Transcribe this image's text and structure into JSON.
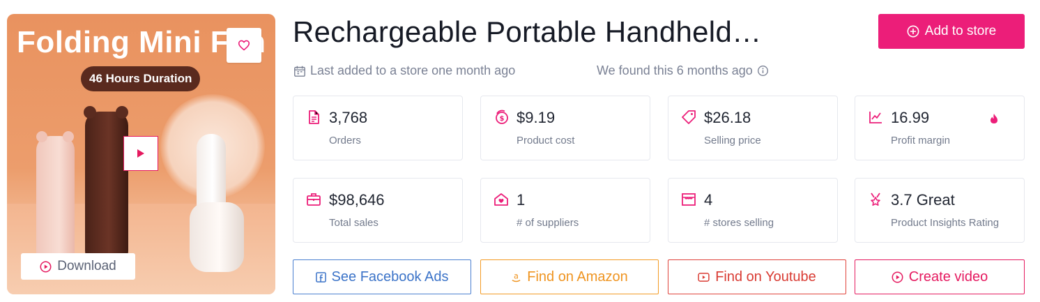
{
  "colors": {
    "accent": "#ec1e79",
    "facebook": "#4a7fd0",
    "amazon": "#f39a23",
    "youtube": "#e0433b",
    "video": "#e5195f"
  },
  "hero": {
    "title": "Folding Mini Fan",
    "pill": "46 Hours Duration",
    "download_label": "Download",
    "fav_icon": "heart-icon",
    "play_icon": "play-icon"
  },
  "header": {
    "title": "Rechargeable Portable Handheld…",
    "add_label": "Add to store",
    "last_added": "Last added to a store one month ago",
    "found": "We found this 6 months ago"
  },
  "stats": [
    {
      "icon": "document-icon",
      "value": "3,768",
      "label": "Orders"
    },
    {
      "icon": "coins-icon",
      "value": "$9.19",
      "label": "Product cost"
    },
    {
      "icon": "tag-icon",
      "value": "$26.18",
      "label": "Selling price"
    },
    {
      "icon": "chart-line-icon",
      "value": "16.99",
      "label": "Profit margin"
    },
    {
      "icon": "briefcase-icon",
      "value": "$98,646",
      "label": "Total sales"
    },
    {
      "icon": "supplier-icon",
      "value": "1",
      "label": "# of suppliers"
    },
    {
      "icon": "store-icon",
      "value": "4",
      "label": "# stores selling"
    },
    {
      "icon": "award-icon",
      "value": "3.7 Great",
      "label": "Product Insights Rating"
    }
  ],
  "actions": {
    "facebook": "See Facebook Ads",
    "amazon": "Find on Amazon",
    "youtube": "Find on Youtube",
    "video": "Create video"
  }
}
